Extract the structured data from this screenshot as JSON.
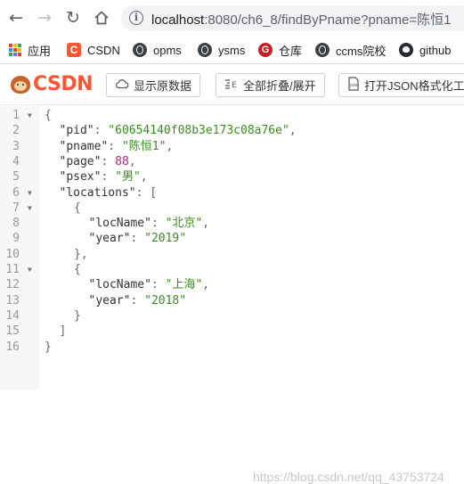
{
  "browser": {
    "url_host": "localhost",
    "url_rest": ":8080/ch6_8/findByPname?pname=陈恒1"
  },
  "bookmarks": [
    {
      "label": "应用",
      "icon": "apps-icon"
    },
    {
      "label": "CSDN",
      "icon": "csdn-icon"
    },
    {
      "label": "opms",
      "icon": "globe-icon"
    },
    {
      "label": "ysms",
      "icon": "globe-icon"
    },
    {
      "label": "仓库",
      "icon": "gitee-icon"
    },
    {
      "label": "ccms院校",
      "icon": "globe-icon"
    },
    {
      "label": "github",
      "icon": "github-icon"
    }
  ],
  "extension": {
    "logo": "CSDN",
    "buttons": [
      {
        "label": "显示原数据",
        "icon": "cloud-icon"
      },
      {
        "label": "全部折叠/展开",
        "icon": "collapse-icon"
      },
      {
        "label": "打开JSON格式化工具",
        "icon": "json-icon"
      }
    ]
  },
  "json_lines": [
    {
      "num": "1",
      "fold": "▼",
      "indent": 0,
      "parts": [
        {
          "t": "{",
          "c": "p"
        }
      ]
    },
    {
      "num": "2",
      "fold": "",
      "indent": 1,
      "parts": [
        {
          "t": "\"pid\"",
          "c": "k"
        },
        {
          "t": ": ",
          "c": "p"
        },
        {
          "t": "\"60654140f08b3e173c08a76e\"",
          "c": "s"
        },
        {
          "t": ",",
          "c": "p"
        }
      ]
    },
    {
      "num": "3",
      "fold": "",
      "indent": 1,
      "parts": [
        {
          "t": "\"pname\"",
          "c": "k"
        },
        {
          "t": ": ",
          "c": "p"
        },
        {
          "t": "\"陈恒1\"",
          "c": "s"
        },
        {
          "t": ",",
          "c": "p"
        }
      ]
    },
    {
      "num": "4",
      "fold": "",
      "indent": 1,
      "parts": [
        {
          "t": "\"page\"",
          "c": "k"
        },
        {
          "t": ": ",
          "c": "p"
        },
        {
          "t": "88",
          "c": "n"
        },
        {
          "t": ",",
          "c": "p"
        }
      ]
    },
    {
      "num": "5",
      "fold": "",
      "indent": 1,
      "parts": [
        {
          "t": "\"psex\"",
          "c": "k"
        },
        {
          "t": ": ",
          "c": "p"
        },
        {
          "t": "\"男\"",
          "c": "s"
        },
        {
          "t": ",",
          "c": "p"
        }
      ]
    },
    {
      "num": "6",
      "fold": "▼",
      "indent": 1,
      "parts": [
        {
          "t": "\"locations\"",
          "c": "k"
        },
        {
          "t": ": [",
          "c": "p"
        }
      ]
    },
    {
      "num": "7",
      "fold": "▼",
      "indent": 2,
      "parts": [
        {
          "t": "{",
          "c": "p"
        }
      ]
    },
    {
      "num": "8",
      "fold": "",
      "indent": 3,
      "parts": [
        {
          "t": "\"locName\"",
          "c": "k"
        },
        {
          "t": ": ",
          "c": "p"
        },
        {
          "t": "\"北京\"",
          "c": "s"
        },
        {
          "t": ",",
          "c": "p"
        }
      ]
    },
    {
      "num": "9",
      "fold": "",
      "indent": 3,
      "parts": [
        {
          "t": "\"year\"",
          "c": "k"
        },
        {
          "t": ": ",
          "c": "p"
        },
        {
          "t": "\"2019\"",
          "c": "s"
        }
      ]
    },
    {
      "num": "10",
      "fold": "",
      "indent": 2,
      "parts": [
        {
          "t": "},",
          "c": "p"
        }
      ]
    },
    {
      "num": "11",
      "fold": "▼",
      "indent": 2,
      "parts": [
        {
          "t": "{",
          "c": "p"
        }
      ]
    },
    {
      "num": "12",
      "fold": "",
      "indent": 3,
      "parts": [
        {
          "t": "\"locName\"",
          "c": "k"
        },
        {
          "t": ": ",
          "c": "p"
        },
        {
          "t": "\"上海\"",
          "c": "s"
        },
        {
          "t": ",",
          "c": "p"
        }
      ]
    },
    {
      "num": "13",
      "fold": "",
      "indent": 3,
      "parts": [
        {
          "t": "\"year\"",
          "c": "k"
        },
        {
          "t": ": ",
          "c": "p"
        },
        {
          "t": "\"2018\"",
          "c": "s"
        }
      ]
    },
    {
      "num": "14",
      "fold": "",
      "indent": 2,
      "parts": [
        {
          "t": "}",
          "c": "p"
        }
      ]
    },
    {
      "num": "15",
      "fold": "",
      "indent": 1,
      "parts": [
        {
          "t": "]",
          "c": "p"
        }
      ]
    },
    {
      "num": "16",
      "fold": "",
      "indent": 0,
      "parts": [
        {
          "t": "}",
          "c": "p"
        }
      ]
    }
  ],
  "watermark": "https://blog.csdn.net/qq_43753724",
  "colors": {
    "csdn_brand": "#fc5531",
    "json_string": "#3a8e1b",
    "json_number": "#b7287b"
  }
}
